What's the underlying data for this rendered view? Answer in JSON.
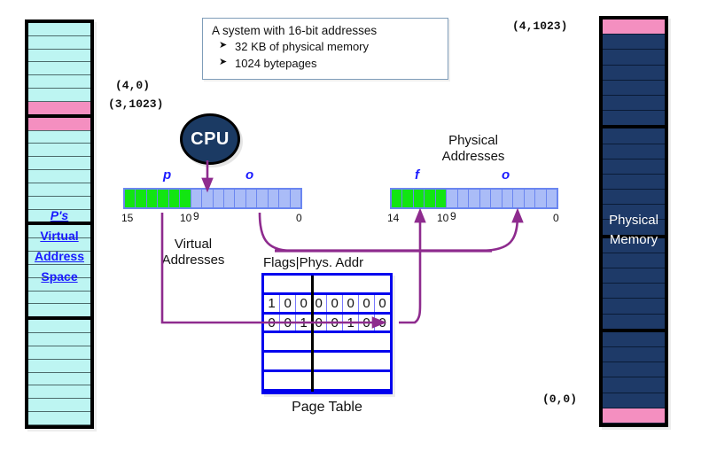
{
  "infobox": {
    "title": "A system with 16-bit addresses",
    "bullets": [
      "32 KB of physical memory",
      "1024 bytepages"
    ]
  },
  "cpu": {
    "label": "CPU"
  },
  "virtual_space": {
    "top_coord": "(4,0)",
    "second_coord": "(3,1023)",
    "label_lines": [
      "P's",
      "Virtual",
      "Address",
      "Space"
    ],
    "cell_count": 30,
    "pink_cells": [
      6,
      7
    ],
    "group_dividers": [
      6,
      14,
      21
    ],
    "cell_color": "#bdf5f2",
    "pink_color": "#f48fc0"
  },
  "physical_memory": {
    "top_coord": "(4,1023)",
    "bottom_coord": "(0,0)",
    "label_lines": [
      "Physical",
      "Memory"
    ],
    "cell_count": 26,
    "pink_cells": [
      0,
      25
    ],
    "group_dividers": [
      6,
      13,
      19
    ],
    "cell_color": "#1e3a68",
    "pink_color": "#f48fc0"
  },
  "virtual_address": {
    "heading_lines": [
      "Virtual",
      "Addresses"
    ],
    "field_p": "p",
    "field_o": "o",
    "bit_labels": {
      "high": "15",
      "mid_high": "10",
      "mid_low": "9",
      "low": "0"
    },
    "green_bits": 6,
    "blue_bits": 10
  },
  "physical_address": {
    "heading_lines": [
      "Physical",
      "Addresses"
    ],
    "field_f": "f",
    "field_o": "o",
    "bit_labels": {
      "high": "14",
      "mid_high": "10",
      "mid_low": "9",
      "low": "0"
    },
    "green_bits": 5,
    "blue_bits": 10
  },
  "page_table": {
    "header": "Flags|Phys. Addr",
    "caption": "Page Table",
    "flag_bits": 3,
    "addr_bits": 5,
    "rows": [
      {
        "flags": [
          "",
          "",
          ""
        ],
        "addr": [
          "",
          "",
          "",
          "",
          ""
        ]
      },
      {
        "flags": [
          "1",
          "0",
          "0"
        ],
        "addr": [
          "0",
          "0",
          "0",
          "0",
          "0"
        ]
      },
      {
        "flags": [
          "0",
          "0",
          "1"
        ],
        "addr": [
          "0",
          "0",
          "1",
          "0",
          "0"
        ]
      },
      {
        "flags": [
          "",
          "",
          ""
        ],
        "addr": [
          "",
          "",
          "",
          "",
          ""
        ]
      },
      {
        "flags": [
          "",
          "",
          ""
        ],
        "addr": [
          "",
          "",
          "",
          "",
          ""
        ]
      },
      {
        "flags": [
          "",
          "",
          ""
        ],
        "addr": [
          "",
          "",
          "",
          "",
          ""
        ]
      }
    ]
  },
  "colors": {
    "arrow": "#8e2b8e",
    "green_bit": "#12e512",
    "blue_bit": "#aabcf7",
    "table_border": "#0000ee",
    "cpu_fill": "#1b3a63"
  }
}
